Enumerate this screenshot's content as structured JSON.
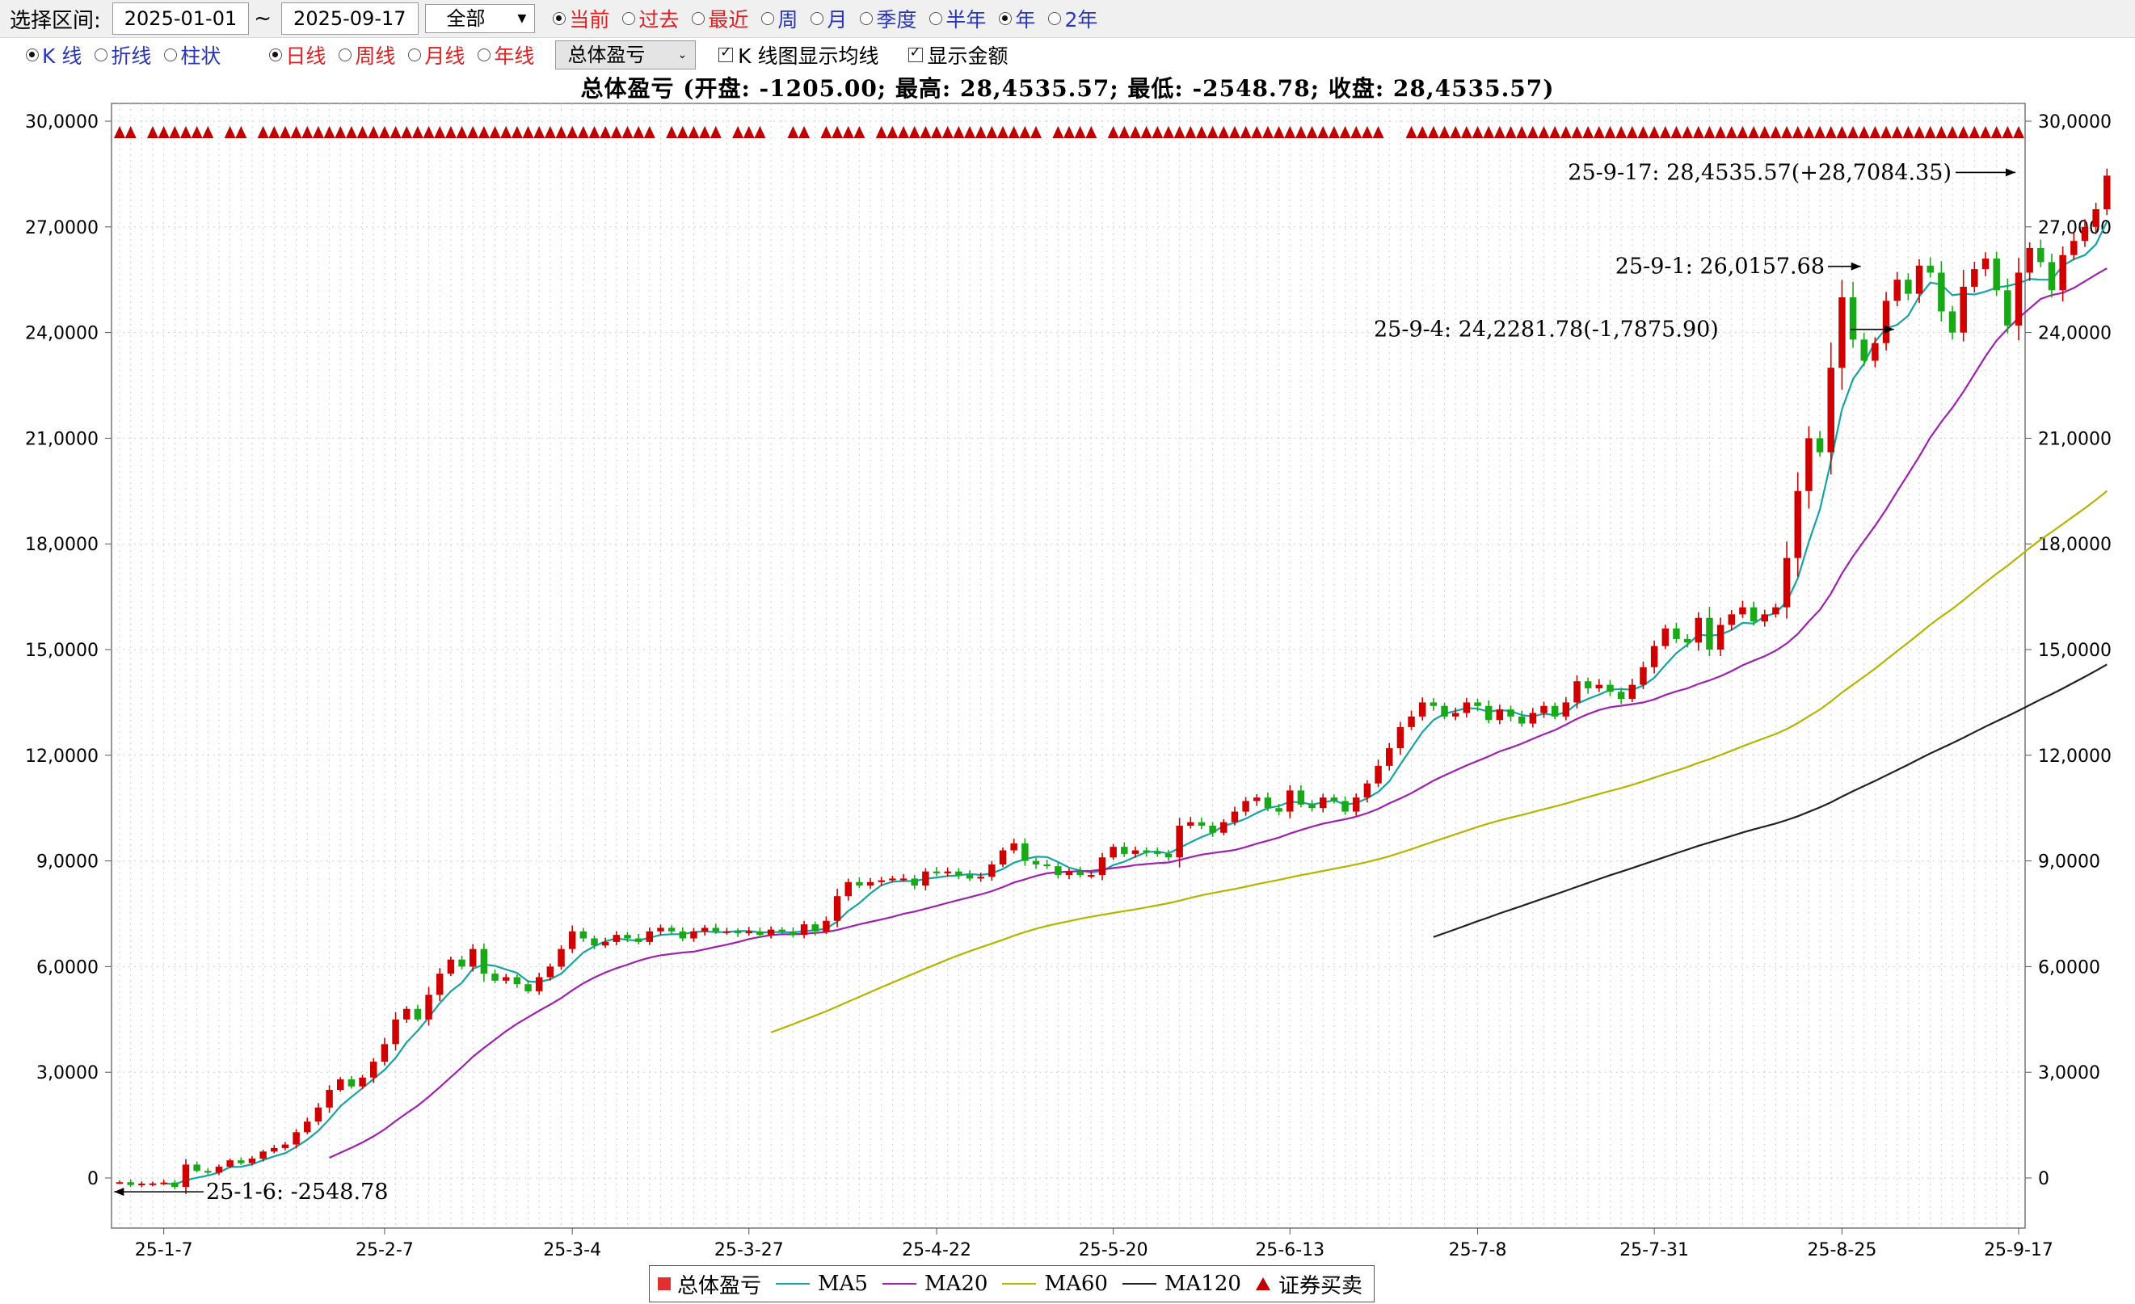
{
  "toolbar": {
    "range_label": "选择区间:",
    "date_from": "2025-01-01",
    "tilde": "~",
    "date_to": "2025-09-17",
    "scope_select": "全部",
    "period_options": [
      {
        "label": "当前",
        "selected": true,
        "color": "red"
      },
      {
        "label": "过去",
        "selected": false,
        "color": "red"
      },
      {
        "label": "最近",
        "selected": false,
        "color": "red"
      },
      {
        "label": "周",
        "selected": false,
        "color": "blue"
      },
      {
        "label": "月",
        "selected": false,
        "color": "blue"
      },
      {
        "label": "季度",
        "selected": false,
        "color": "blue"
      },
      {
        "label": "半年",
        "selected": false,
        "color": "blue"
      },
      {
        "label": "年",
        "selected": true,
        "color": "blue"
      },
      {
        "label": "2年",
        "selected": false,
        "color": "blue"
      }
    ]
  },
  "toolbar2": {
    "chart_types": [
      {
        "label": "K 线",
        "selected": true
      },
      {
        "label": "折线",
        "selected": false
      },
      {
        "label": "柱状",
        "selected": false
      }
    ],
    "frequencies": [
      {
        "label": "日线",
        "selected": true
      },
      {
        "label": "周线",
        "selected": false
      },
      {
        "label": "月线",
        "selected": false
      },
      {
        "label": "年线",
        "selected": false
      }
    ],
    "metric_select": "总体盈亏",
    "show_ma_label": "K 线图显示均线",
    "show_ma_checked": true,
    "show_amount_label": "显示金额",
    "show_amount_checked": true
  },
  "summary": "总体盈亏 (开盘: -1205.00;  最高: 28,4535.57;  最低: -2548.78;  收盘: 28,4535.57)",
  "colors": {
    "up": "#d00000",
    "down": "#18a818",
    "ma5": "#17a3a3",
    "ma20": "#a020b0",
    "ma60": "#b5b500",
    "ma120": "#222222",
    "signal": "#c00000"
  },
  "chart_data": {
    "type": "candlestick",
    "y_axis_labels": [
      "30,0000",
      "27,0000",
      "24,0000",
      "21,0000",
      "18,0000",
      "15,0000",
      "12,0000",
      "9,0000",
      "6,0000",
      "3,0000",
      "0"
    ],
    "ylim": [
      -1500,
      300000
    ],
    "x_ticks": [
      "25-1-7",
      "25-2-7",
      "25-3-4",
      "25-3-27",
      "25-4-22",
      "25-5-20",
      "25-6-13",
      "25-7-8",
      "25-7-31",
      "25-8-25",
      "25-9-17"
    ],
    "num_sessions": 173,
    "closes": [
      -1205,
      -2000,
      -1600,
      -1550,
      -1300,
      -2548.78,
      3800,
      2000,
      1500,
      3200,
      5000,
      4200,
      5500,
      7500,
      8500,
      9500,
      13000,
      16000,
      20000,
      25000,
      28000,
      26000,
      28500,
      33000,
      38000,
      45000,
      48000,
      45000,
      52000,
      58000,
      62000,
      60000,
      65000,
      58000,
      56000,
      57000,
      55000,
      53000,
      57000,
      60000,
      65000,
      70000,
      68000,
      66000,
      67000,
      69000,
      68000,
      67000,
      70000,
      71000,
      70000,
      68000,
      70000,
      71000,
      70000,
      70000,
      69500,
      70000,
      69000,
      70500,
      70000,
      69000,
      72000,
      70000,
      73000,
      80000,
      84000,
      83000,
      84000,
      84500,
      85000,
      85000,
      83000,
      87000,
      86500,
      87000,
      86000,
      85000,
      85500,
      89000,
      93000,
      95000,
      90000,
      89000,
      88500,
      86000,
      87000,
      86000,
      86000,
      91000,
      94000,
      92000,
      93000,
      92500,
      92000,
      91000,
      100000,
      101000,
      100000,
      98000,
      101000,
      104000,
      107000,
      108000,
      105000,
      104000,
      110000,
      106000,
      105000,
      108000,
      107000,
      104000,
      108000,
      112000,
      117000,
      122000,
      128000,
      131000,
      135000,
      134000,
      131000,
      132000,
      135000,
      134000,
      130000,
      133000,
      131000,
      129000,
      132000,
      134000,
      131000,
      135000,
      141000,
      139000,
      140000,
      138000,
      136000,
      140000,
      145000,
      151000,
      156000,
      153000,
      152000,
      159000,
      150000,
      157000,
      160000,
      162000,
      158000,
      160000,
      162000,
      176000,
      195000,
      210000,
      206000,
      230000,
      250000,
      238000,
      232000,
      237000,
      249000,
      255000,
      251000,
      259000,
      257000,
      246000,
      240000,
      253000,
      258000,
      261000,
      252000,
      242000,
      257000,
      264000,
      260000,
      252000,
      262000,
      266000,
      270000,
      275000,
      284535.57
    ],
    "series": [
      {
        "name": "MA5"
      },
      {
        "name": "MA20"
      },
      {
        "name": "MA60"
      },
      {
        "name": "MA120"
      }
    ],
    "annotations": [
      {
        "text": "25-9-17: 28,4535.57(+28,7084.35)",
        "session": 172,
        "value": 284535.57
      },
      {
        "text": "25-9-1: 26,0157.68",
        "session": 158,
        "value": 260157.68
      },
      {
        "text": "25-9-4: 24,2281.78(-1,7875.90)",
        "session": 161,
        "value": 242281.78
      },
      {
        "text": "25-1-6: -2548.78",
        "session": 5,
        "value": -2548.78
      }
    ],
    "signal_sessions": [
      0,
      1,
      3,
      4,
      5,
      6,
      7,
      8,
      10,
      11,
      13,
      14,
      15,
      16,
      17,
      18,
      19,
      20,
      21,
      22,
      23,
      24,
      25,
      26,
      27,
      28,
      29,
      30,
      31,
      32,
      33,
      34,
      35,
      36,
      37,
      38,
      39,
      40,
      41,
      42,
      43,
      44,
      45,
      46,
      47,
      48,
      50,
      51,
      52,
      53,
      54,
      56,
      57,
      58,
      61,
      62,
      64,
      65,
      66,
      67,
      69,
      70,
      71,
      72,
      73,
      74,
      75,
      76,
      77,
      78,
      79,
      80,
      81,
      82,
      83,
      85,
      86,
      87,
      88,
      90,
      91,
      92,
      93,
      94,
      95,
      96,
      97,
      98,
      99,
      100,
      101,
      102,
      103,
      104,
      105,
      106,
      107,
      108,
      109,
      110,
      111,
      112,
      113,
      114,
      117,
      118,
      119,
      120,
      121,
      122,
      123,
      124,
      125,
      126,
      127,
      128,
      129,
      130,
      131,
      132,
      133,
      134,
      135,
      136,
      137,
      138,
      139,
      140,
      141,
      142,
      143,
      144,
      145,
      146,
      147,
      148,
      149,
      150,
      151,
      152,
      153,
      154,
      155,
      156,
      157,
      158,
      159,
      160,
      161,
      162,
      163,
      164,
      165,
      166,
      167,
      168,
      169,
      170,
      171,
      172
    ]
  },
  "legend": [
    {
      "label": "总体盈亏",
      "kind": "square",
      "color": "#e03030"
    },
    {
      "label": "MA5",
      "kind": "line",
      "color": "#17a3a3"
    },
    {
      "label": "MA20",
      "kind": "line",
      "color": "#a020b0"
    },
    {
      "label": "MA60",
      "kind": "line",
      "color": "#b5b500"
    },
    {
      "label": "MA120",
      "kind": "line",
      "color": "#222222"
    },
    {
      "label": "证券买卖",
      "kind": "triangle",
      "color": "#c00000"
    }
  ]
}
